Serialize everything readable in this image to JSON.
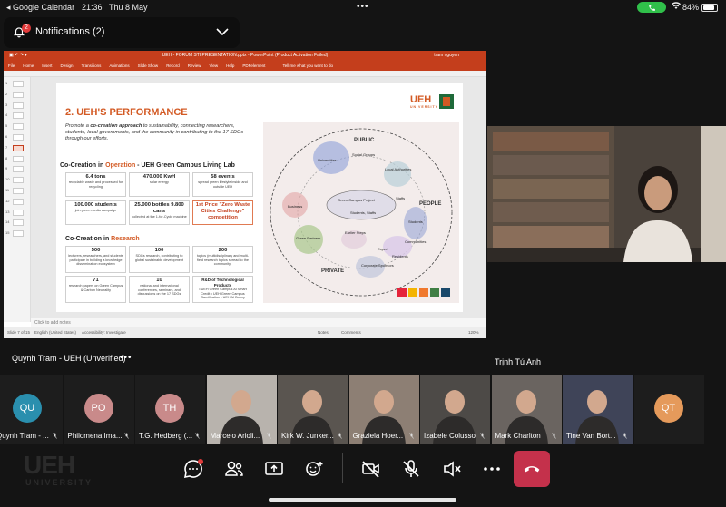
{
  "status_bar": {
    "back_app": "◂ Google Calendar",
    "time": "21:36",
    "date": "Thu 8 May",
    "battery": "84%",
    "battery_level": 0.84
  },
  "notification": {
    "count_badge": "2",
    "label": "Notifications (2)"
  },
  "powerpoint": {
    "title": "UEH - FORUM STI PRESENTATION.pptx - PowerPoint (Product Activation Failed)",
    "user": "tram nguyen",
    "ribbon_tabs": [
      "File",
      "Home",
      "Insert",
      "Design",
      "Transitions",
      "Animations",
      "Slide Show",
      "Record",
      "Review",
      "View",
      "Help",
      "PDFelement"
    ],
    "tell_me": "Tell me what you want to do",
    "thumb_numbers": [
      "1",
      "2",
      "3",
      "4",
      "5",
      "6",
      "7",
      "8",
      "9",
      "10",
      "11",
      "12",
      "13",
      "14",
      "15"
    ],
    "notes_placeholder": "Click to add notes",
    "status": {
      "slide_of": "Slide 7 of 15",
      "language": "English (United States)",
      "accessibility": "Accessibility: Investigate",
      "notes": "Notes",
      "comments": "Comments",
      "zoom": "120%"
    }
  },
  "slide": {
    "title": "2. UEH'S PERFORMANCE",
    "intro_pre": "Promote a ",
    "intro_bold": "co-creation approach",
    "intro_post": " to sustainability, connecting researchers, students, local governments, and the community in contributing to the 17 SDGs through our efforts.",
    "logo_text_a": "UEH",
    "logo_text_b": "UNIVERSITY",
    "operation_heading_pre": "Co-Creation in ",
    "operation_heading_hl": "Operation",
    "operation_heading_post": " - UEH Green Campus Living Lab",
    "operation_boxes": [
      {
        "big": "6.4 tons",
        "small": "recyclable waste and processed for recycling"
      },
      {
        "big": "470.000 KwH",
        "small": "solar energy"
      },
      {
        "big": "58 events",
        "small": "spread green lifestyle inside and outside UEH"
      },
      {
        "big": "100.000 students",
        "small": "join green media campaign"
      },
      {
        "big": "25.000 bottles 9.800 cans",
        "small": "collected at the 1-for-Cycle machine"
      },
      {
        "big": "1st Price \"Zero Waste Cities Challenge\" competition",
        "small": ""
      }
    ],
    "research_heading_pre": "Co-Creation in ",
    "research_heading_hl": "Research",
    "research_boxes": [
      {
        "big": "500",
        "small": "lecturers, researchers, and students participate in building a knowledge dissemination ecosystem"
      },
      {
        "big": "100",
        "small": "SDGs research, contributing to global sustainable development"
      },
      {
        "big": "200",
        "small": "topics (multidisciplinary and multi-field research topics spread to the community)"
      },
      {
        "big": "71",
        "small": "research papers on Green Campus & Carbon Neutrality"
      },
      {
        "big": "10",
        "small": "national and international conferences, seminars, and discussions on the 17 SDGs"
      },
      {
        "big": "R&D of Technological Products",
        "small": "• UEH Green Campus Al Smart Credit • UEH Green Campus Gamification • UEH AI Bunny"
      }
    ],
    "diagram": {
      "public": "PUBLIC",
      "people": "PEOPLE",
      "private": "PRIVATE",
      "universities": "Universities",
      "social_groups": "Social Groups",
      "local_authorities": "Local Authorities",
      "business": "Business",
      "green_campus": "Green Campus Project",
      "students_staffs": "Students, Staffs",
      "staffs": "Staffs",
      "students": "Students",
      "communities": "Communities",
      "green_partners": "Green Partners",
      "expert": "Expert",
      "residents": "Residents",
      "corporate_sponsors": "Corporate Sponsors",
      "earlier_steps": "Earlier Steps"
    }
  },
  "local_user": {
    "name": "Quynh Tram - UEH (Unverified)",
    "more": "•••"
  },
  "speaker": {
    "name": "Trịnh Tú Anh"
  },
  "participants": [
    {
      "name": "Quynh Tram - ...",
      "initials": "QU",
      "color": "#2a8fae"
    },
    {
      "name": "Philomena Ima...",
      "initials": "PO",
      "color": "#c98a8a"
    },
    {
      "name": "T.G. Hedberg (...",
      "initials": "TH",
      "color": "#c98a8a"
    },
    {
      "name": "Marcelo Arioli...",
      "initials": ""
    },
    {
      "name": "Kirk W. Junker...",
      "initials": ""
    },
    {
      "name": "Graziela Hoer...",
      "initials": ""
    },
    {
      "name": "Izabele Colusso",
      "initials": ""
    },
    {
      "name": "Mark Charlton",
      "initials": ""
    },
    {
      "name": "Tine Van Bort...",
      "initials": ""
    },
    {
      "name": "",
      "initials": "QT",
      "color": "#e59a5b"
    }
  ],
  "watermark": {
    "main": "UEH",
    "sub": "UNIVERSITY"
  },
  "colors": {
    "ppt_red": "#c43e1c",
    "accent_orange": "#d35a24",
    "ueh_green": "#1f6a3a",
    "end_call": "#c4314b",
    "call_green": "#30c04a"
  }
}
